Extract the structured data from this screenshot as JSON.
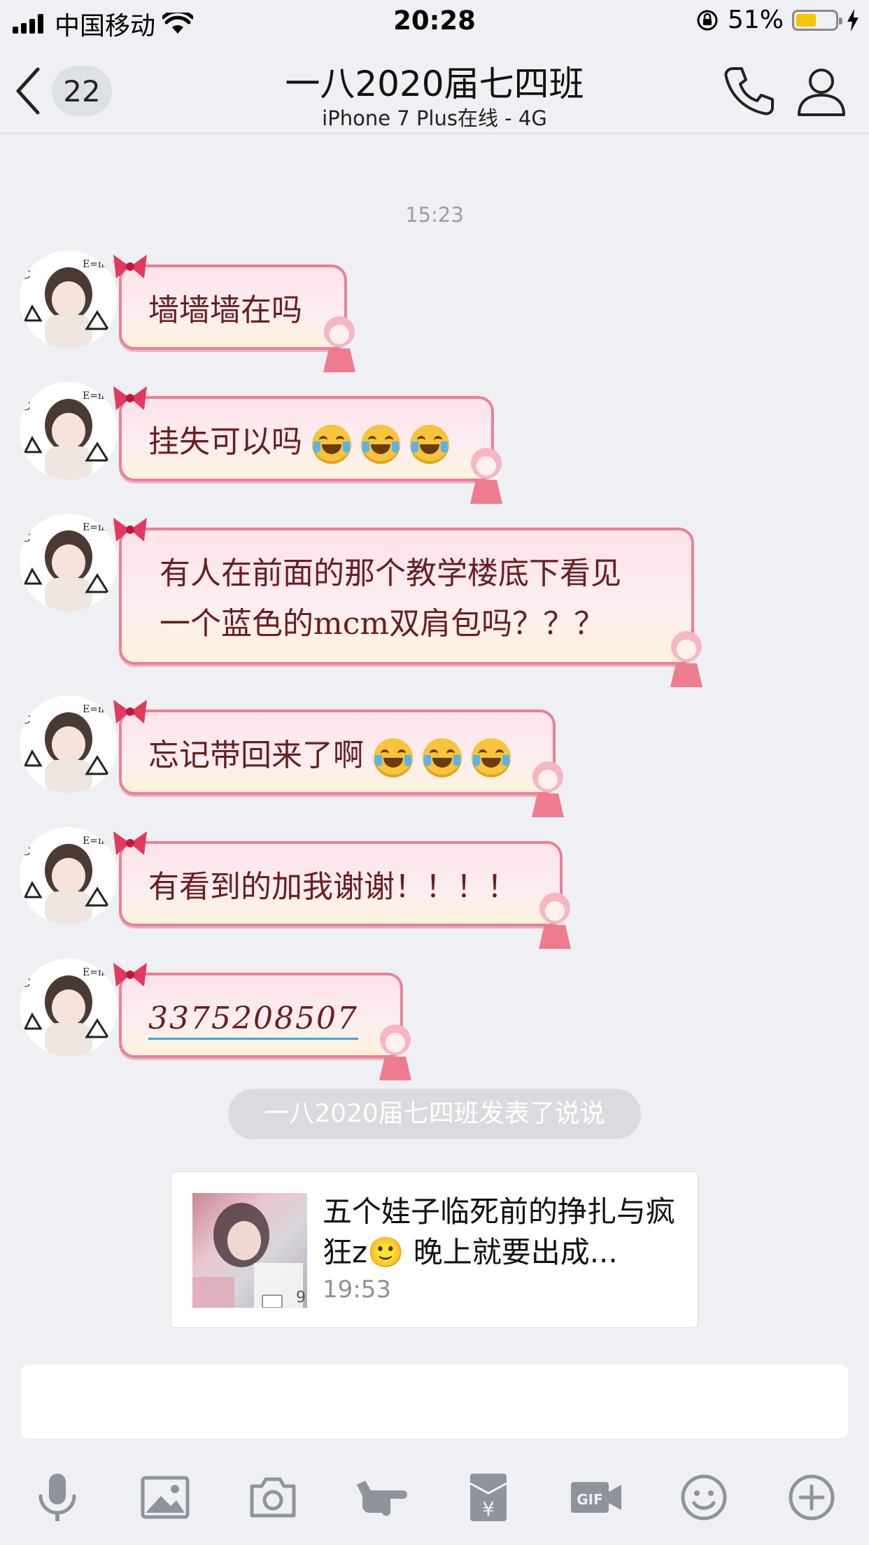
{
  "status_bar": {
    "carrier": "中国移动",
    "time": "20:28",
    "battery_percent": "51%",
    "battery_level": 0.51
  },
  "nav": {
    "back_badge": "22",
    "title": "一八2020届七四班",
    "subtitle": "iPhone 7 Plus在线 - 4G"
  },
  "chat": {
    "timestamp": "15:23",
    "messages": [
      {
        "text": "墙墙墙在吗",
        "emoji_count": 0
      },
      {
        "text": "挂失可以吗",
        "emoji_count": 3
      },
      {
        "line1": "有人在前面的那个教学楼底下看见",
        "line2": "一个蓝色的mcm双肩包吗？？？"
      },
      {
        "text": "忘记带回来了啊",
        "emoji_count": 3
      },
      {
        "text": "有看到的加我谢谢！！！！"
      },
      {
        "text": "3375208507"
      }
    ],
    "system_notice": "一八2020届七四班发表了说说",
    "share_card": {
      "title": "五个娃子临死前的挣扎与疯狂z🙂 晚上就要出成...",
      "time": "19:53",
      "thumb_badge": "9"
    }
  },
  "input": {
    "placeholder": ""
  },
  "toolbar": {
    "items": [
      "microphone-icon",
      "image-icon",
      "camera-icon",
      "poke-icon",
      "red-packet-icon",
      "gif-icon",
      "emoji-icon",
      "plus-icon"
    ]
  },
  "colors": {
    "background": "#eef0f4",
    "bubble_border": "#ec7f99",
    "bubble_text": "#6b1d22",
    "link_underline": "#3ea6d8",
    "battery": "#f7c600"
  }
}
